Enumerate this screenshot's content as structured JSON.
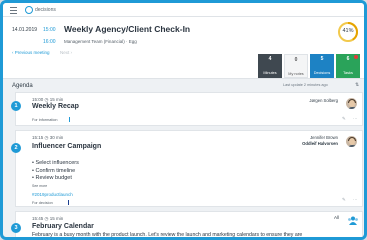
{
  "app": {
    "logo_text": "decisions"
  },
  "meeting": {
    "date": "14.01.2019",
    "start_time": "15:00",
    "title": "Weekly Agency/Client Check-In",
    "end_time": "16:00",
    "team": "Management Team (Financial) · Egg",
    "prev_label": "‹ Previous meeting",
    "next_label": "Next ›",
    "progress_percent": 41,
    "progress_label": "41%"
  },
  "stats": [
    {
      "count": "4",
      "label": "Minutes"
    },
    {
      "count": "0",
      "label": "My notes"
    },
    {
      "count": "5",
      "label": "Decisions"
    },
    {
      "count": "6",
      "label": "Tasks"
    }
  ],
  "agenda": {
    "label": "Agenda",
    "last_update": "Last update 2 minutes ago"
  },
  "items": [
    {
      "number": "1",
      "time": "15:00 ◷ 15 min",
      "title": "Weekly Recap",
      "person": "Jørgen Solberg",
      "chip": "For information"
    },
    {
      "number": "2",
      "time": "15:15 ◷ 30 min",
      "title": "Influencer Campaign",
      "person_1": "Jennifer Brown",
      "person_2": "Oddleif Halvorsen",
      "bullets": [
        "Select influencers",
        "Confirm timeline",
        "Review budget"
      ],
      "see_more": "See more",
      "hashtag": "#2019productlaunch",
      "chip": "For decision"
    },
    {
      "number": "3",
      "time": "15:45 ◷ 15 min",
      "title": "February Calendar",
      "audience": "All",
      "description": "February is a busy month with the product launch. Let's review the launch and marketing calendars to ensure they are"
    }
  ],
  "colors": {
    "accent": "#1f9ad6",
    "minutes": "#3f4850",
    "decisions": "#1d82c4",
    "tasks": "#2aa35a",
    "progress_track": "#f2c94c"
  }
}
